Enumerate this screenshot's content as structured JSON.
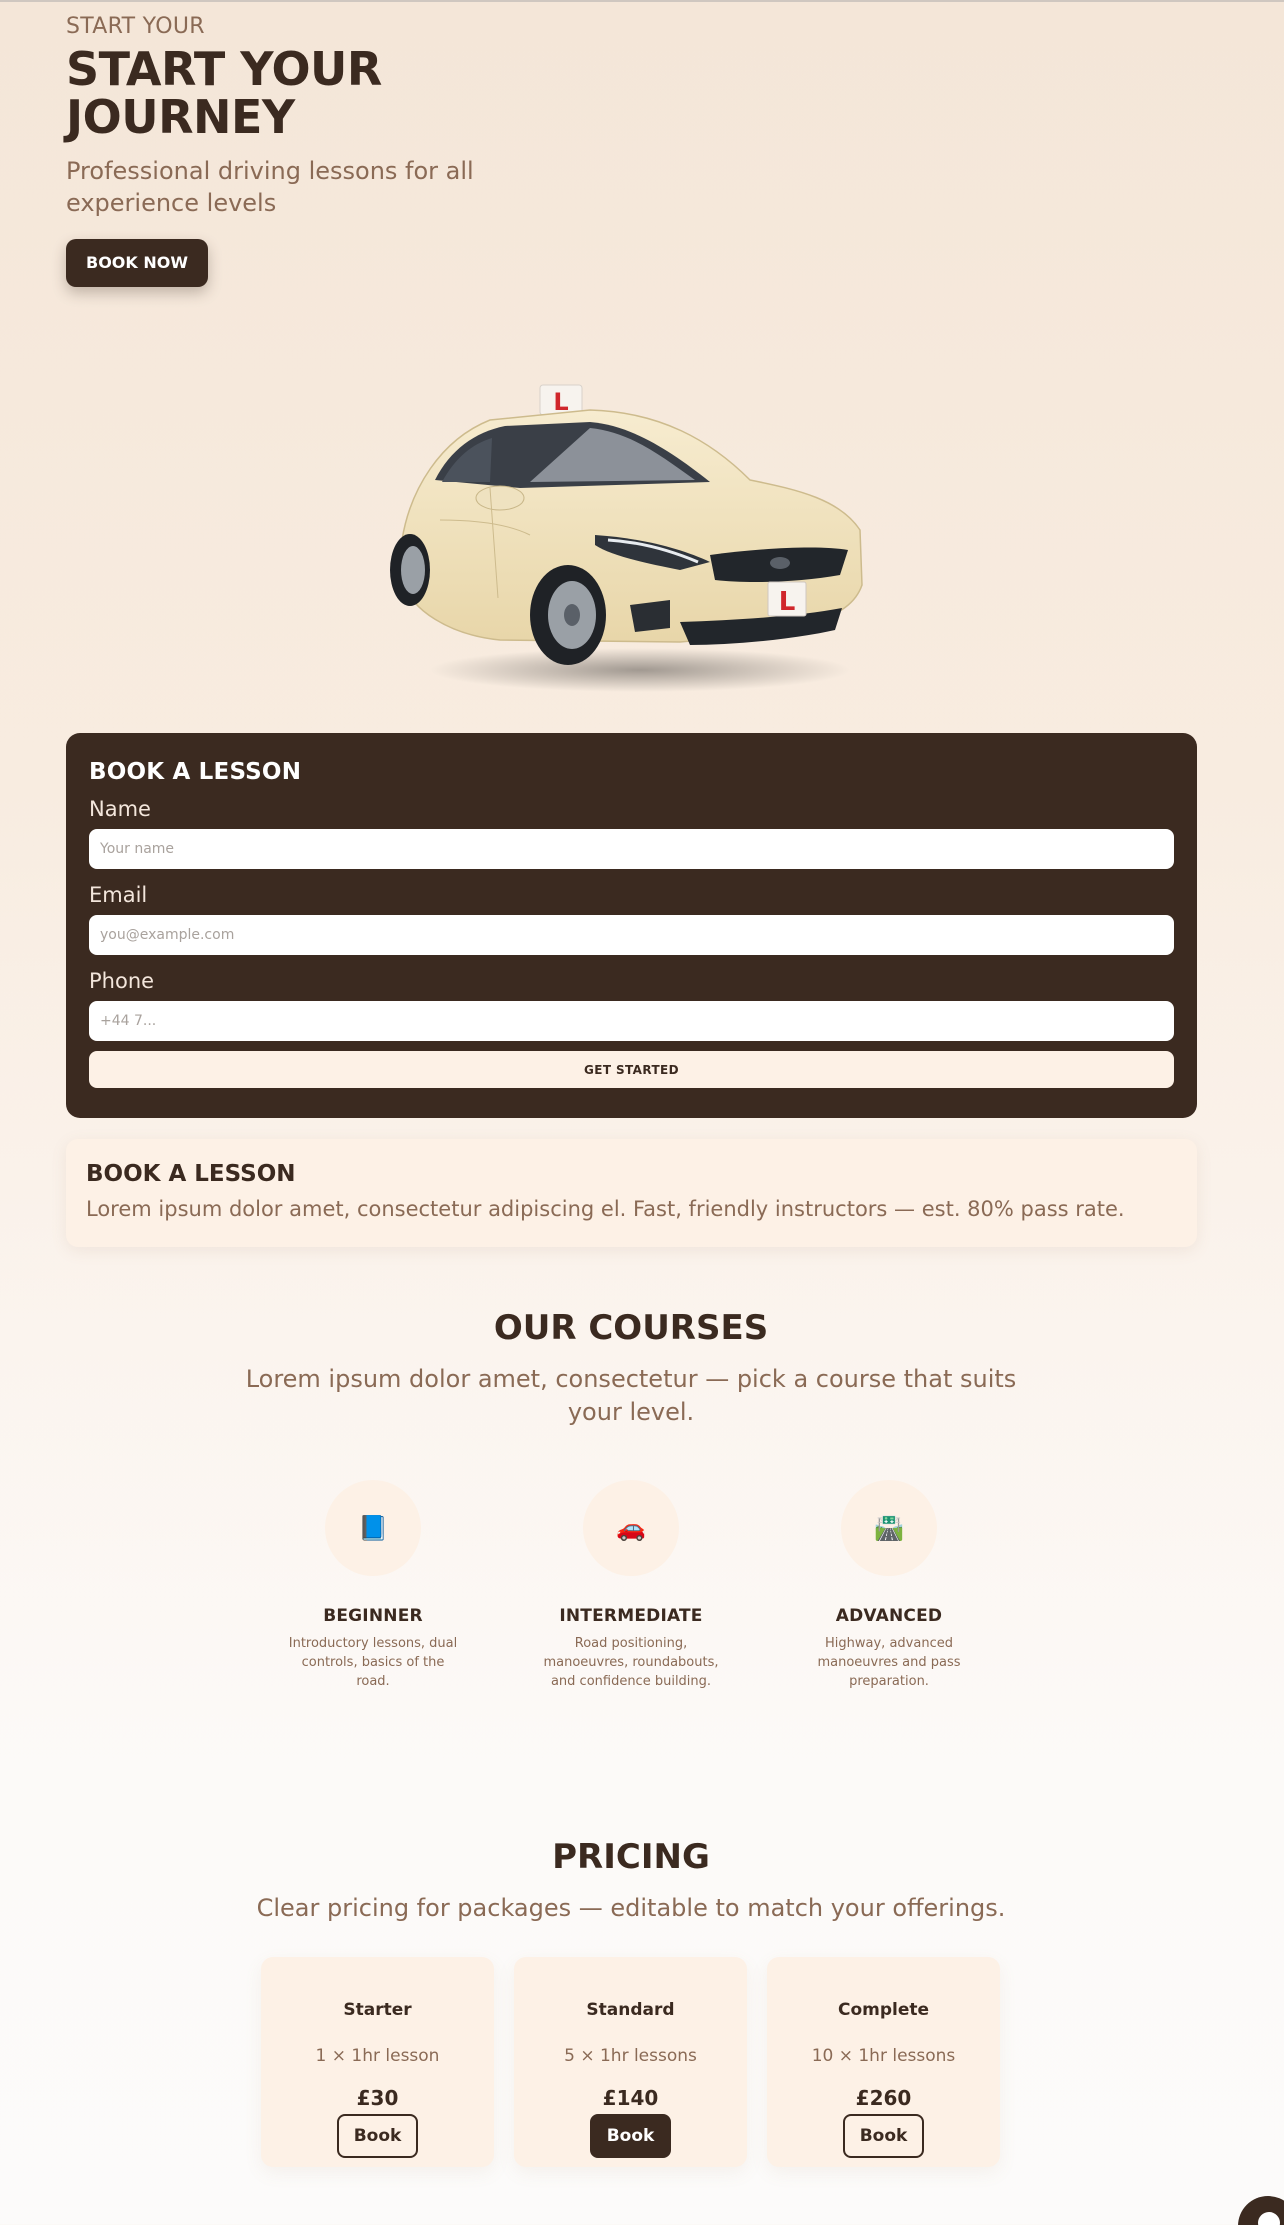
{
  "hero": {
    "eyebrow": "START YOUR",
    "title": "START YOUR JOURNEY",
    "subtitle": "Professional driving lessons for all experience levels",
    "cta_label": "BOOK NOW"
  },
  "car": {
    "plate_letter": "L",
    "roof_sign_letter": "L"
  },
  "booking_form": {
    "title": "BOOK A LESSON",
    "name_label": "Name",
    "name_placeholder": "Your name",
    "email_label": "Email",
    "email_placeholder": "you@example.com",
    "phone_label": "Phone",
    "phone_placeholder": "+44 7...",
    "submit_label": "GET STARTED"
  },
  "info": {
    "title": "BOOK A LESSON",
    "text": "Lorem ipsum dolor amet, consectetur adipiscing el. Fast, friendly instructors — est. 80% pass rate."
  },
  "courses": {
    "title": "OUR COURSES",
    "subtitle": "Lorem ipsum dolor amet, consectetur — pick a course that suits your level.",
    "items": [
      {
        "icon": "book-icon",
        "glyph": "📘",
        "name": "BEGINNER",
        "desc": "Introductory lessons, dual controls, basics of the road."
      },
      {
        "icon": "car-icon",
        "glyph": "🚗",
        "name": "INTERMEDIATE",
        "desc": "Road positioning, manoeuvres, roundabouts, and confidence building."
      },
      {
        "icon": "motorway-icon",
        "glyph": "🛣️",
        "name": "ADVANCED",
        "desc": "Highway, advanced manoeuvres and pass preparation."
      }
    ]
  },
  "pricing": {
    "title": "PRICING",
    "subtitle": "Clear pricing for packages — editable to match your offerings.",
    "plans": [
      {
        "name": "Starter",
        "lessons": "1 × 1hr lesson",
        "price": "£30",
        "button": "Book"
      },
      {
        "name": "Standard",
        "lessons": "5 × 1hr lessons",
        "price": "£140",
        "button": "Book"
      },
      {
        "name": "Complete",
        "lessons": "10 × 1hr lessons",
        "price": "£260",
        "button": "Book"
      }
    ]
  },
  "colors": {
    "brand_dark": "#3b2a20",
    "accent_muted": "#8a6a55",
    "card_cream": "#fdf1e6",
    "car_body": "#f1e3bd",
    "learner_red": "#d0262b"
  }
}
